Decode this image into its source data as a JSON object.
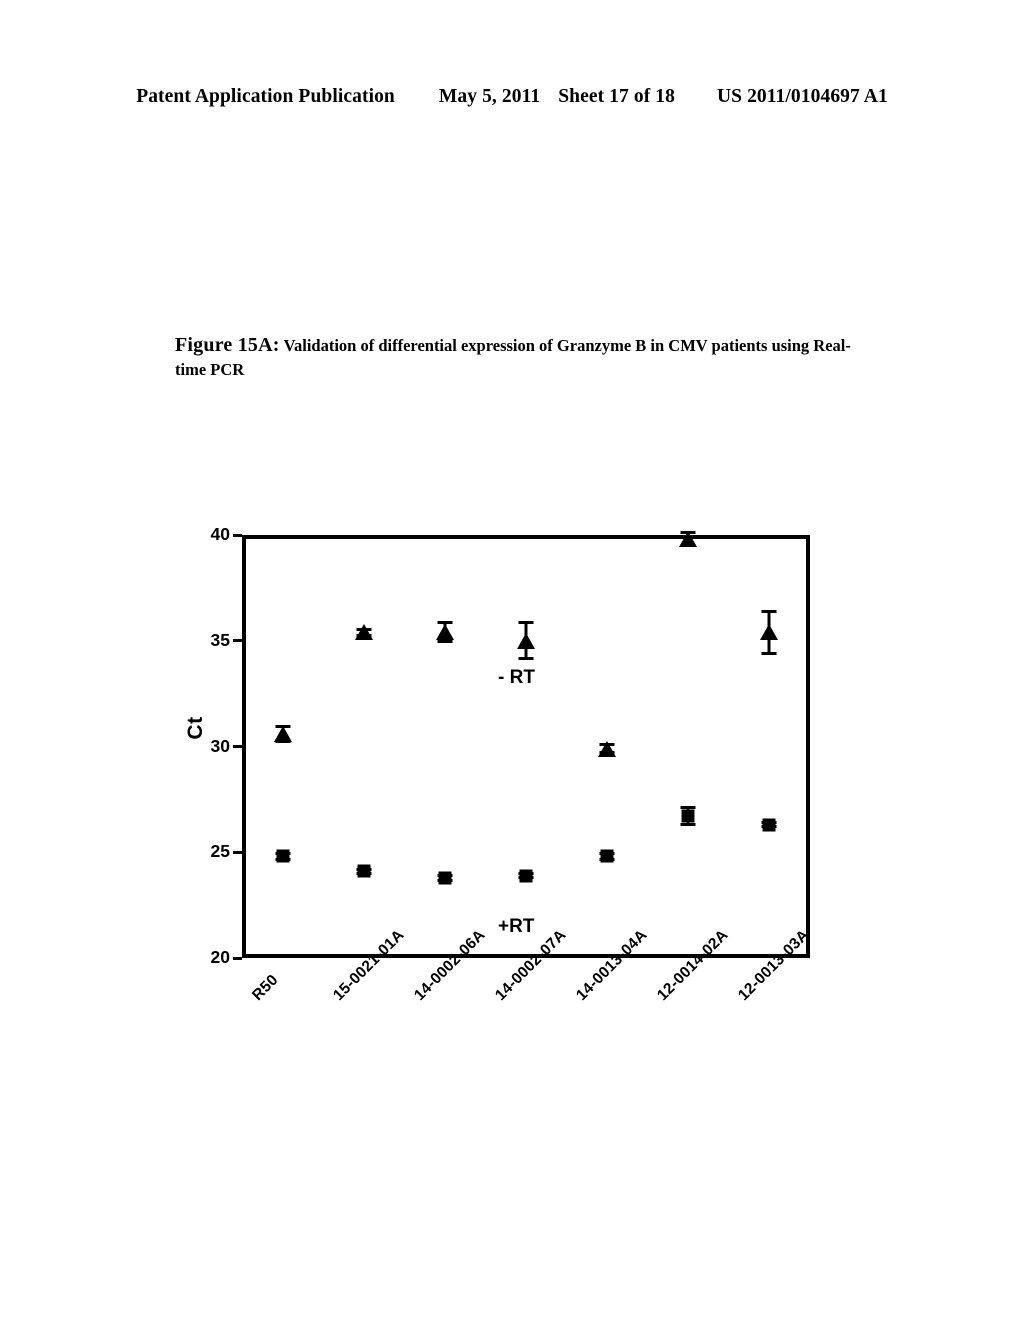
{
  "header": {
    "publication": "Patent Application Publication",
    "date": "May 5, 2011",
    "sheet": "Sheet 17 of 18",
    "number": "US 2011/0104697 A1"
  },
  "figure": {
    "label": "Figure 15A:",
    "caption": "Validation of differential expression of Granzyme B in CMV patients using Real-time PCR"
  },
  "chart_data": {
    "type": "scatter",
    "title": "",
    "xlabel": "",
    "ylabel": "Ct",
    "ylim": [
      20,
      40
    ],
    "yticks": [
      20,
      25,
      30,
      35,
      40
    ],
    "ytick_labels": [
      "20",
      "25",
      "30",
      "35",
      "40"
    ],
    "grid": false,
    "legend": "none",
    "categories": [
      "R50",
      "15-0021-01A",
      "14-0002-06A",
      "14-0002-07A",
      "14-0013-04A",
      "12-0014-02A",
      "12-0013-03A"
    ],
    "annotations": [
      {
        "text": "- RT",
        "x_category": "14-0002-07A",
        "y_value": 33.2
      },
      {
        "text": "+RT",
        "x_category": "14-0002-07A",
        "y_value": 21.4
      }
    ],
    "series": [
      {
        "name": "- RT",
        "marker": "triangle",
        "color": "#000000",
        "values": [
          30.6,
          35.4,
          35.4,
          35.0,
          29.9,
          39.8,
          35.4
        ],
        "errors": [
          0.35,
          0.15,
          0.45,
          0.85,
          0.2,
          0.3,
          1.0
        ]
      },
      {
        "name": "+RT",
        "marker": "square",
        "color": "#000000",
        "values": [
          24.8,
          24.1,
          23.8,
          23.9,
          24.8,
          26.7,
          26.3
        ],
        "errors": [
          0.15,
          0.1,
          0.12,
          0.1,
          0.12,
          0.4,
          0.1
        ]
      }
    ]
  }
}
